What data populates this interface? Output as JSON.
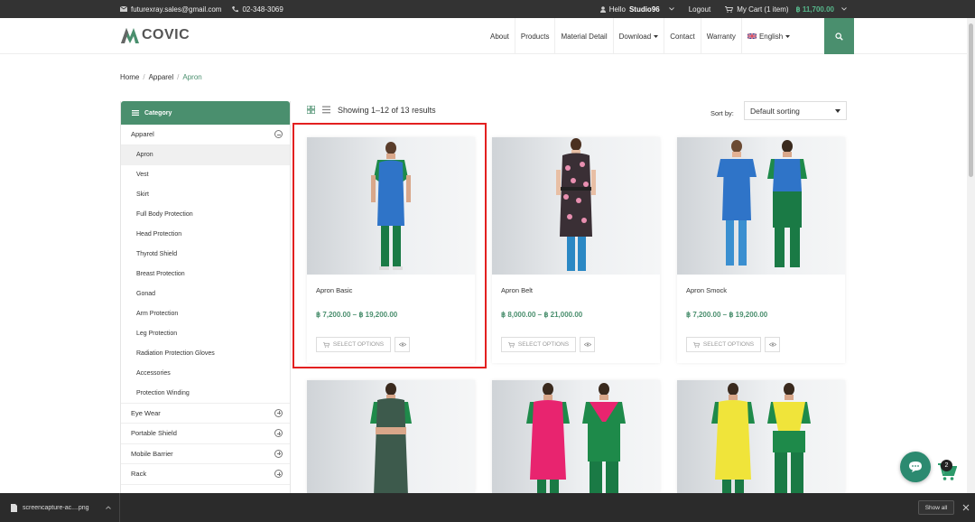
{
  "topbar": {
    "email": "futurexray.sales@gmail.com",
    "phone": "02-348-3069",
    "hello": "Hello",
    "user": "Studio96",
    "logout": "Logout",
    "cart_label": "My Cart (1 item)",
    "cart_total": "฿ 11,700.00"
  },
  "header": {
    "logo_text": "COVIC",
    "nav": [
      "About",
      "Products",
      "Material Detail",
      "Download",
      "Contact",
      "Warranty",
      "English"
    ]
  },
  "breadcrumb": [
    "Home",
    "Apparel",
    "Apron"
  ],
  "sidebar": {
    "title": "Category",
    "parent": "Apparel",
    "subitems": [
      "Apron",
      "Vest",
      "Skirt",
      "Full Body Protection",
      "Head Protection",
      "Thyrotd Shield",
      "Breast Protection",
      "Gonad",
      "Arm Protection",
      "Leg Protection",
      "Radiation Protection Gloves",
      "Accessories",
      "Protection Winding"
    ],
    "others": [
      "Eye Wear",
      "Portable Shield",
      "Mobile Barrier",
      "Rack"
    ]
  },
  "toolbar": {
    "result_count": "Showing 1–12 of 13 results",
    "sort_label": "Sort by:",
    "sort_value": "Default sorting"
  },
  "products": [
    {
      "title": "Apron Basic",
      "price": "฿ 7,200.00 – ฿ 19,200.00",
      "button": "SELECT OPTIONS"
    },
    {
      "title": "Apron Belt",
      "price": "฿ 8,000.00 – ฿ 21,000.00",
      "button": "SELECT OPTIONS"
    },
    {
      "title": "Apron Smock",
      "price": "฿ 7,200.00 – ฿ 19,200.00",
      "button": "SELECT OPTIONS"
    }
  ],
  "cart_float": {
    "count": "2"
  },
  "download_bar": {
    "filename": "screencapture-ac....png",
    "show_all": "Show all"
  },
  "colors": {
    "brand_green": "#4a8f6e",
    "highlight": "#e32020"
  }
}
